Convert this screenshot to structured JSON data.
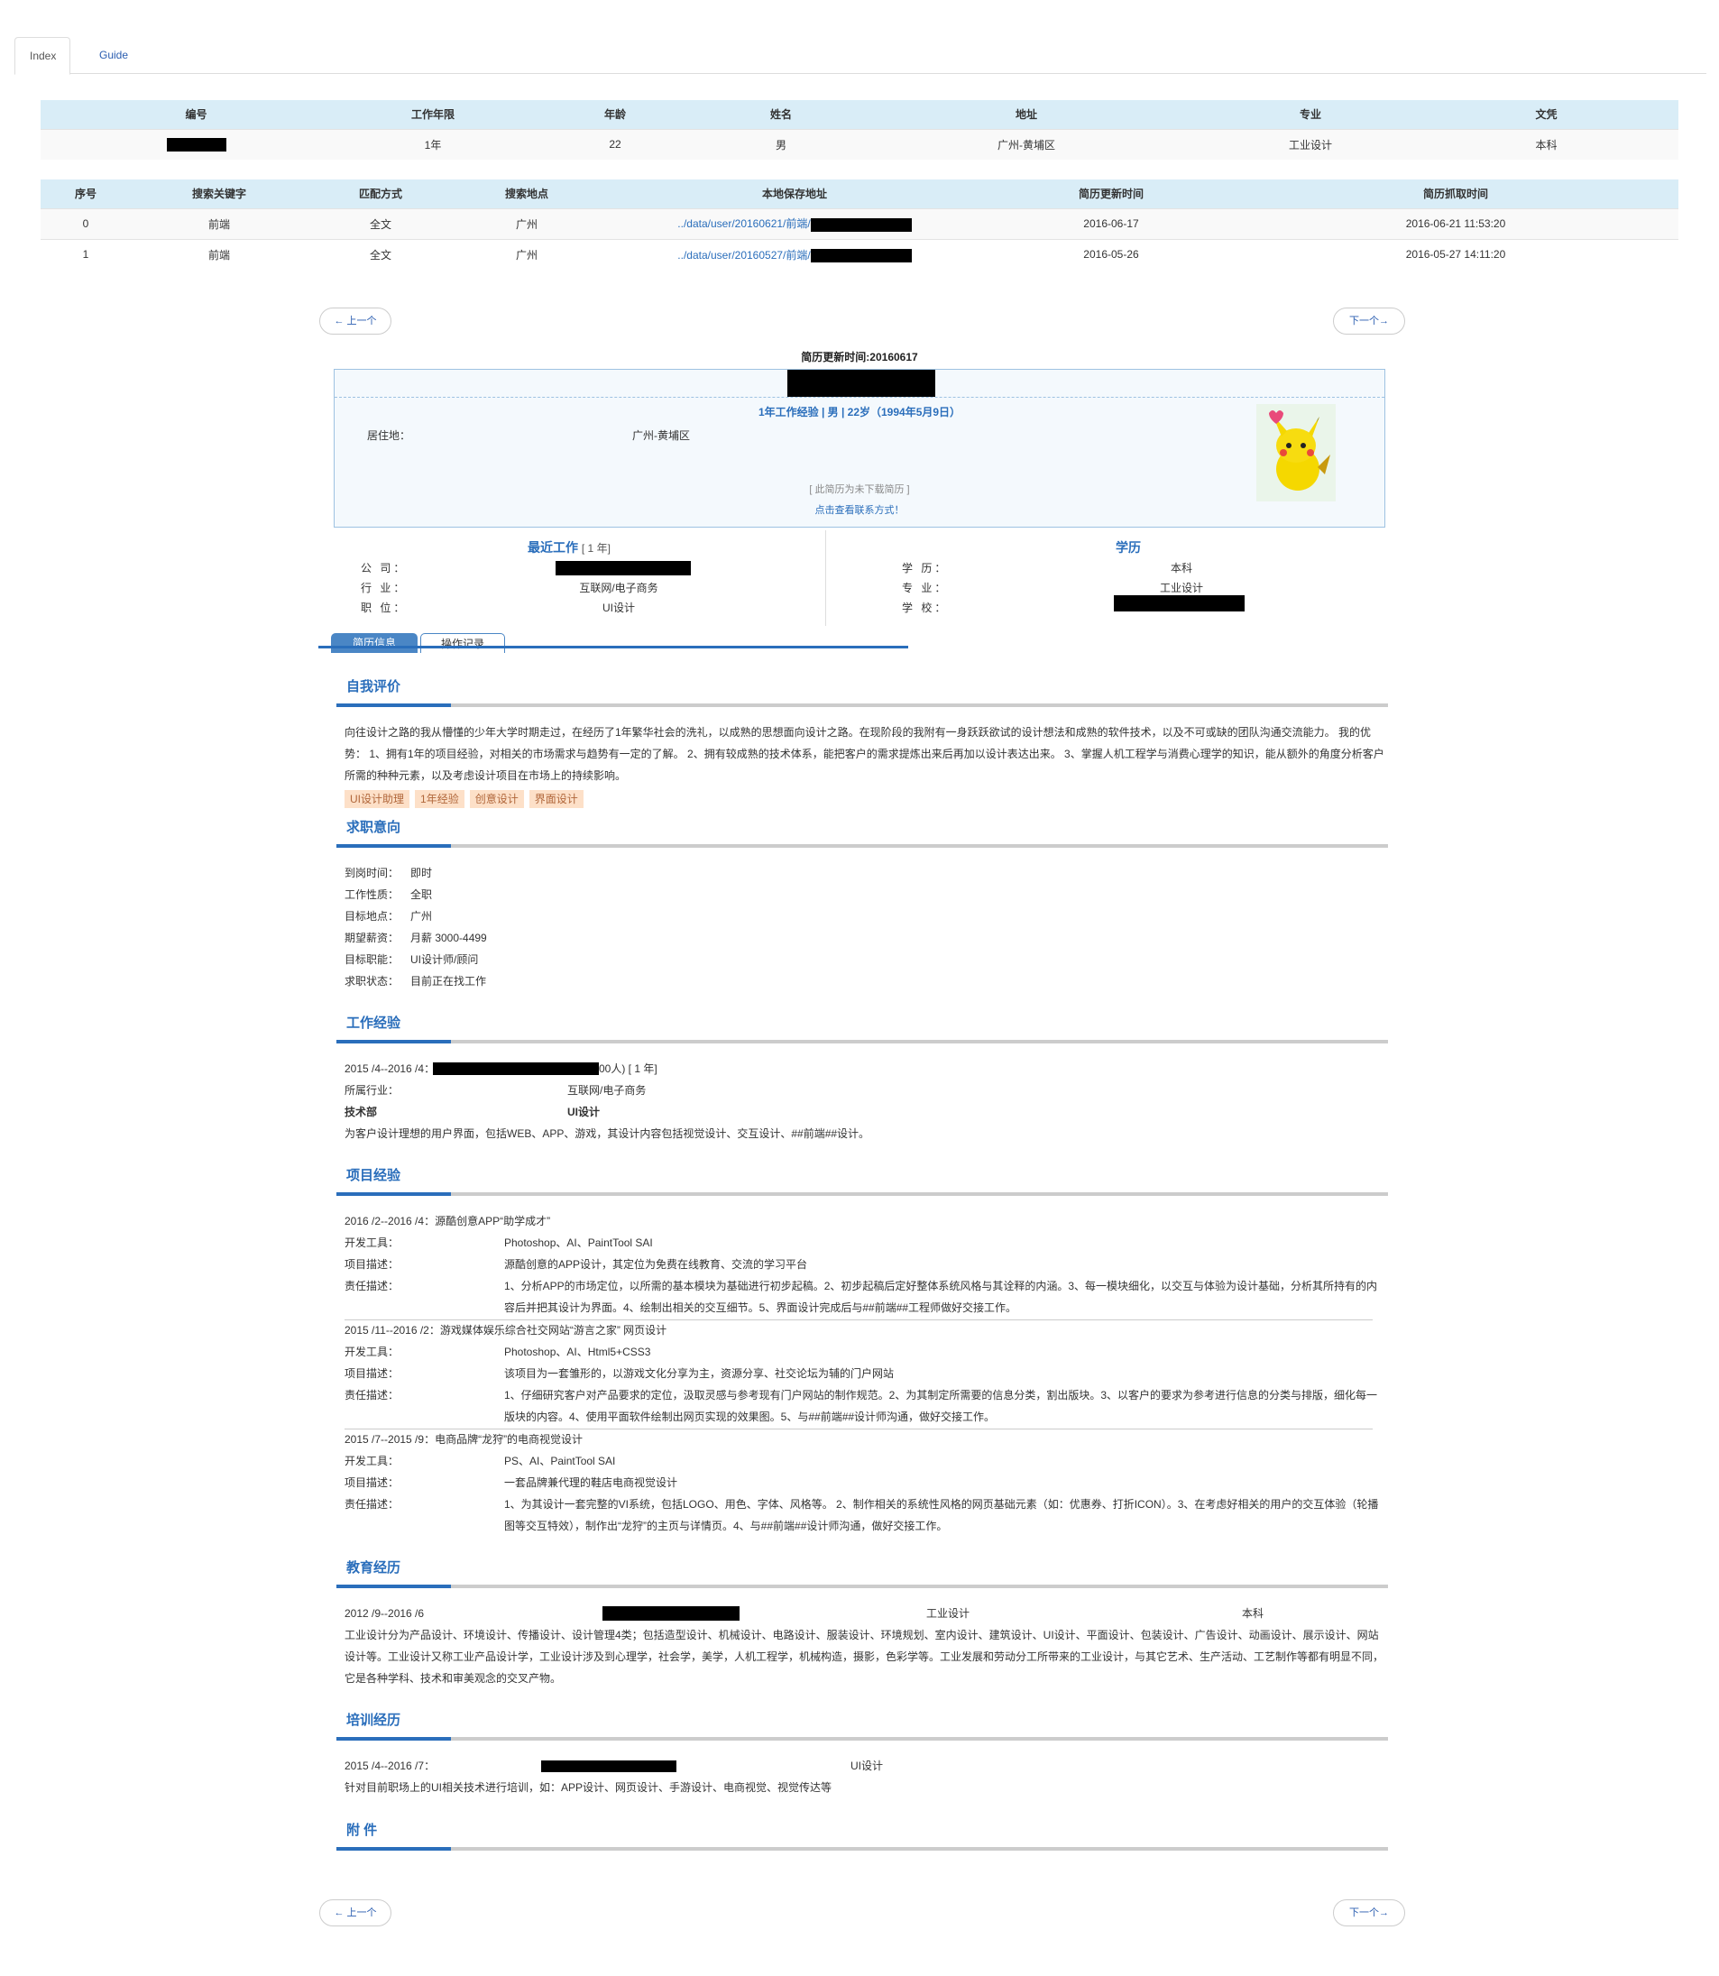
{
  "tabs": {
    "index": "Index",
    "guide": "Guide"
  },
  "table1": {
    "headers": [
      "编号",
      "工作年限",
      "年龄",
      "姓名",
      "地址",
      "专业",
      "文凭"
    ],
    "row": [
      "",
      "1年",
      "22",
      "男",
      "广州-黄埔区",
      "工业设计",
      "本科"
    ]
  },
  "table2": {
    "headers": [
      "序号",
      "搜索关键字",
      "匹配方式",
      "搜索地点",
      "本地保存地址",
      "简历更新时间",
      "简历抓取时间"
    ],
    "rows": [
      [
        "0",
        "前端",
        "全文",
        "广州",
        "../data/user/20160621/前端/",
        "2016-06-17",
        "2016-06-21 11:53:20"
      ],
      [
        "1",
        "前端",
        "全文",
        "广州",
        "../data/user/20160527/前端/",
        "2016-05-26",
        "2016-05-27 14:11:20"
      ]
    ]
  },
  "pager": {
    "prev": "← 上一个",
    "next": "下一个→"
  },
  "resume": {
    "updated": "简历更新时间:20160617",
    "summary": "1年工作经验 | 男 |  22岁（1994年5月9日）",
    "residence_label": "居住地：",
    "residence_value": "广州-黄埔区",
    "note": "[ 此简历为未下载简历 ]",
    "contact": "点击查看联系方式！",
    "recent_job": {
      "title": "最近工作",
      "years": "[ 1 年]",
      "company_label": "公    司：",
      "industry_label": "行    业：",
      "industry_value": "互联网/电子商务",
      "position_label": "职    位：",
      "position_value": "UI设计"
    },
    "education": {
      "title": "学历",
      "degree_label": "学    历：",
      "degree_value": "本科",
      "major_label": "专    业：",
      "major_value": "工业设计",
      "school_label": "学    校："
    },
    "tabs": {
      "info": "简历信息",
      "log": "操作记录"
    },
    "self_eval": {
      "title": "自我评价",
      "lines": [
        "向往设计之路的我从懵懂的少年大学时期走过，在经历了1年繁华社会的洗礼，以成熟的思想面向设计之路。在现阶段的我附有一身跃跃欲试的设计想法和成熟的软件技术，以及不可或缺的团队沟通交流能力。 我的优",
        "势： 1、拥有1年的项目经验，对相关的市场需求与趋势有一定的了解。 2、拥有较成熟的技术体系，能把客户的需求提炼出来后再加以设计表达出来。 3、掌握人机工程学与消费心理学的知识，能从额外的角度分析客户",
        "所需的种种元素，以及考虑设计项目在市场上的持续影响。"
      ],
      "tags": [
        "UI设计助理",
        "1年经验",
        "创意设计",
        "界面设计"
      ]
    },
    "intention": {
      "title": "求职意向",
      "items": [
        {
          "label": "到岗时间：",
          "value": "即时"
        },
        {
          "label": "工作性质：",
          "value": "全职"
        },
        {
          "label": "目标地点：",
          "value": "广州"
        },
        {
          "label": "期望薪资：",
          "value": "月薪 3000-4499"
        },
        {
          "label": "目标职能：",
          "value": "UI设计师/顾问"
        },
        {
          "label": "求职状态：",
          "value": "目前正在找工作"
        }
      ]
    },
    "work": {
      "title": "工作经验",
      "period": "2015 /4--2016 /4：",
      "size": "00人)  [ 1 年]",
      "industry_label": "所属行业：",
      "industry_value": "互联网/电子商务",
      "dept": "技术部",
      "role": "UI设计",
      "desc": "为客户设计理想的用户界面，包括WEB、APP、游戏，其设计内容包括视觉设计、交互设计、##前端##设计。"
    },
    "projects": {
      "title": "项目经验",
      "list": [
        {
          "head": "2016 /2--2016 /4：源酷创意APP“助学成才”",
          "tools_label": "开发工具：",
          "tools": "Photoshop、AI、PaintTool SAI",
          "desc_label": "项目描述：",
          "desc": "源酷创意的APP设计，其定位为免费在线教育、交流的学习平台",
          "duty_label": "责任描述：",
          "duty1": "1、分析APP的市场定位，以所需的基本模块为基础进行初步起稿。2、初步起稿后定好整体系统风格与其诠释的内涵。3、每一模块细化，以交互与体验为设计基础，分析其所持有的内",
          "duty2": "容后并把其设计为界面。4、绘制出相关的交互细节。5、界面设计完成后与##前端##工程师做好交接工作。"
        },
        {
          "head": "2015 /11--2016 /2：游戏媒体娱乐综合社交网站“游言之家” 网页设计",
          "tools_label": "开发工具：",
          "tools": "Photoshop、AI、Html5+CSS3",
          "desc_label": "项目描述：",
          "desc": "该项目为一套雏形的，以游戏文化分享为主，资源分享、社交论坛为辅的门户网站",
          "duty_label": "责任描述：",
          "duty1": "1、仔细研究客户对产品要求的定位，汲取灵感与参考现有门户网站的制作规范。2、为其制定所需要的信息分类，割出版块。3、以客户的要求为参考进行信息的分类与排版，细化每一",
          "duty2": "版块的内容。4、使用平面软件绘制出网页实现的效果图。5、与##前端##设计师沟通，做好交接工作。"
        },
        {
          "head": "2015 /7--2015 /9：电商品牌“龙狩”的电商视觉设计",
          "tools_label": "开发工具：",
          "tools": "PS、AI、PaintTool SAI",
          "desc_label": "项目描述：",
          "desc": "一套品牌兼代理的鞋店电商视觉设计",
          "duty_label": "责任描述：",
          "duty1": "1、为其设计一套完整的VI系统，包括LOGO、用色、字体、风格等。 2、制作相关的系统性风格的网页基础元素（如：优惠券、打折ICON）。3、在考虑好相关的用户的交互体验（轮播",
          "duty2": "图等交互特效），制作出“龙狩”的主页与详情页。4、与##前端##设计师沟通，做好交接工作。"
        }
      ]
    },
    "edu_history": {
      "title": "教育经历",
      "period": "2012 /9--2016 /6",
      "major": "工业设计",
      "degree": "本科",
      "lines": [
        "工业设计分为产品设计、环境设计、传播设计、设计管理4类；包括造型设计、机械设计、电路设计、服装设计、环境规划、室内设计、建筑设计、UI设计、平面设计、包装设计、广告设计、动画设计、展示设计、网站",
        "设计等。工业设计又称工业产品设计学，工业设计涉及到心理学，社会学，美学，人机工程学，机械构造，摄影，色彩学等。工业发展和劳动分工所带来的工业设计，与其它艺术、生产活动、工艺制作等都有明显不同，",
        "它是各种学科、技术和审美观念的交叉产物。"
      ]
    },
    "training": {
      "title": "培训经历",
      "period": "2015 /4--2016 /7：",
      "course": "UI设计",
      "desc": "针对目前职场上的UI相关技术进行培训，如：APP设计、网页设计、手游设计、电商视觉、视觉传达等"
    },
    "attachment": {
      "title": "附    件"
    }
  }
}
